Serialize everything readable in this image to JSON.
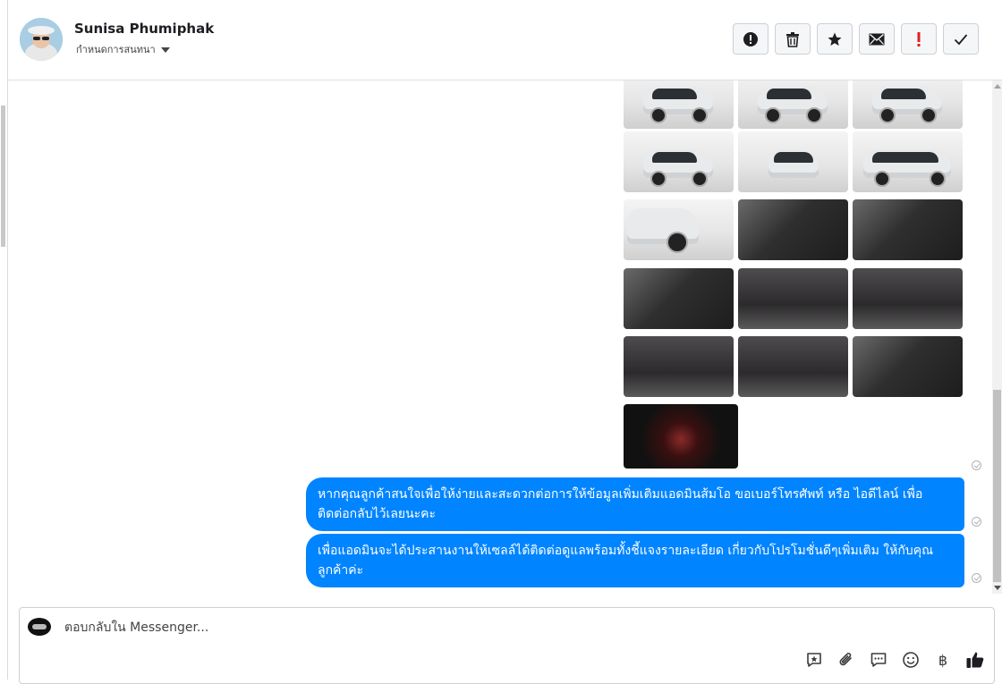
{
  "header": {
    "contact_name": "Sunisa Phumiphak",
    "subtitle": "กำหนดการสนทนา",
    "actions": [
      {
        "name": "report-button",
        "icon": "alert-circle-icon"
      },
      {
        "name": "delete-button",
        "icon": "trash-icon"
      },
      {
        "name": "star-button",
        "icon": "star-icon"
      },
      {
        "name": "mark-unread-button",
        "icon": "envelope-icon"
      },
      {
        "name": "important-button",
        "icon": "exclamation-icon"
      },
      {
        "name": "done-button",
        "icon": "checkmark-icon"
      }
    ]
  },
  "conversation": {
    "photo_count": 16,
    "messages": [
      "หากคุณลูกค้าสนใจเพื่อให้ง่ายและสะดวกต่อการให้ข้อมูลเพิ่มเติมแอดมินส้มโอ ขอเบอร์โทรศัพท์ หรือ ไอดีไลน์ เพื่อติดต่อกลับไว้เลยนะคะ",
      "เพื่อแอดมินจะได้ประสานงานให้เซลล์ได้ติดต่อดูแลพร้อมทั้งชี้แจงรายละเอียด เกี่ยวกับโปรโมชั่นดีๆเพิ่มเติม ให้กับคุณลูกค้าค่ะ"
    ]
  },
  "composer": {
    "placeholder": "ตอบกลับใน Messenger...",
    "tools": [
      "saved-reply-icon",
      "attachment-icon",
      "chat-icon",
      "emoji-icon",
      "baht-payment-icon",
      "thumbs-up-icon"
    ],
    "baht_symbol": "฿"
  },
  "colors": {
    "bubble": "#0084ff",
    "important": "#e02020"
  }
}
